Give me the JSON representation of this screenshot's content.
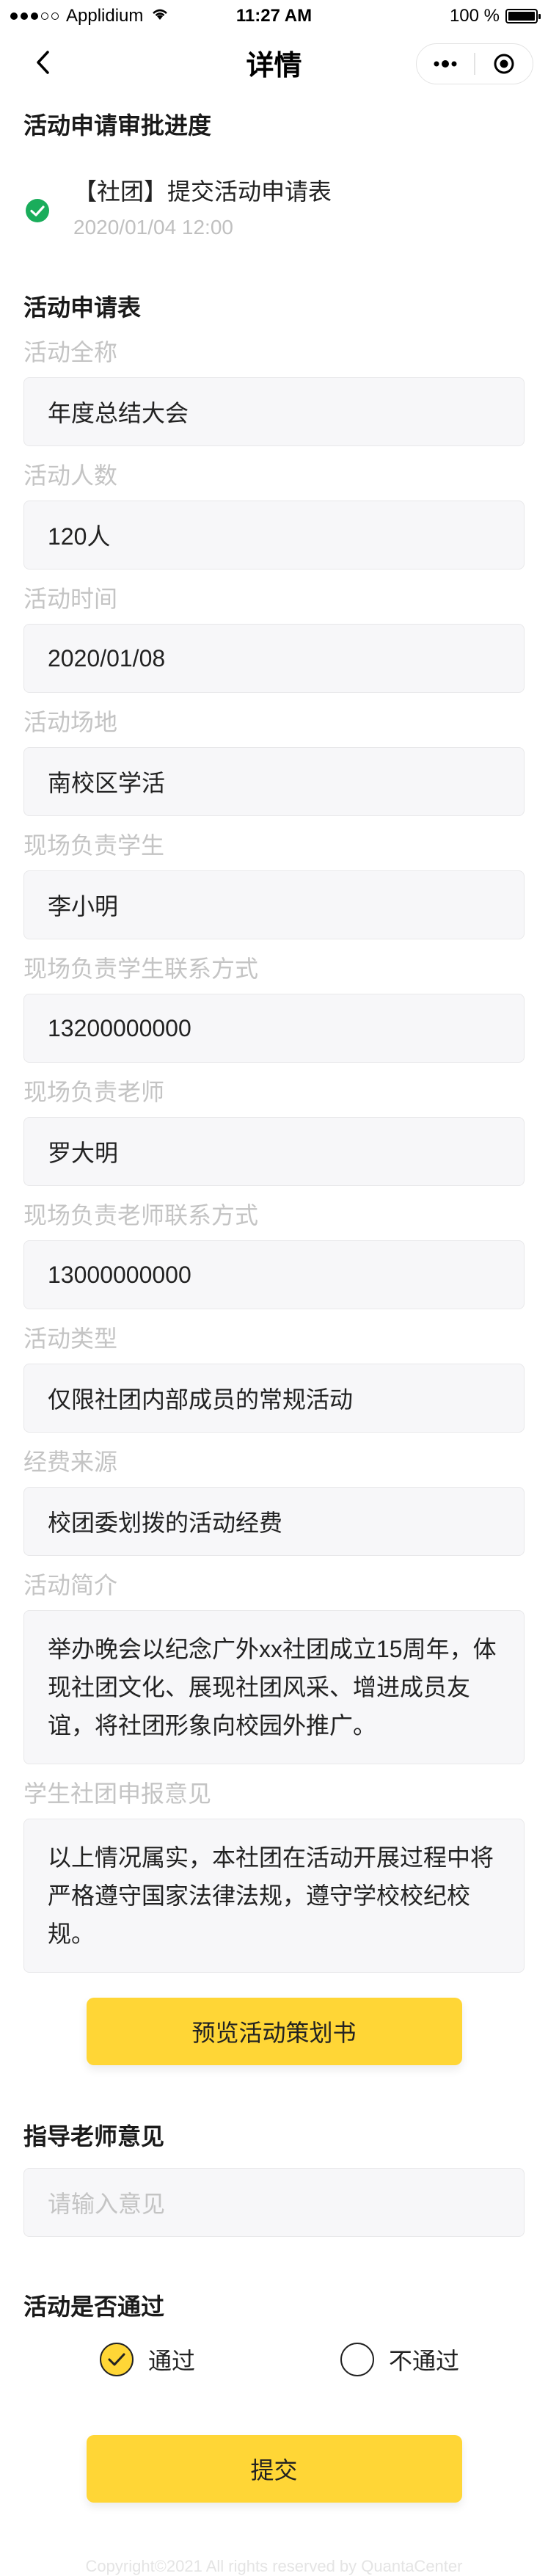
{
  "status_bar": {
    "carrier": "Applidium",
    "time": "11:27 AM",
    "battery": "100 %"
  },
  "nav": {
    "title": "详情",
    "back_icon": "chevron-left-icon",
    "more_icon": "more-dots-icon",
    "close_icon": "target-circle-icon"
  },
  "approval": {
    "section_title": "活动申请审批进度",
    "step_title": "【社团】提交活动申请表",
    "step_time": "2020/01/04 12:00",
    "status_icon": "check-circle-icon",
    "status_color": "#1aad5b"
  },
  "form": {
    "title": "活动申请表",
    "fields": [
      {
        "label": "活动全称",
        "value": "年度总结大会"
      },
      {
        "label": "活动人数",
        "value": "120人"
      },
      {
        "label": "活动时间",
        "value": "2020/01/08"
      },
      {
        "label": "活动场地",
        "value": "南校区学活"
      },
      {
        "label": "现场负责学生",
        "value": "李小明"
      },
      {
        "label": "现场负责学生联系方式",
        "value": "13200000000"
      },
      {
        "label": "现场负责老师",
        "value": "罗大明"
      },
      {
        "label": "现场负责老师联系方式",
        "value": "13000000000"
      },
      {
        "label": "活动类型",
        "value": "仅限社团内部成员的常规活动"
      },
      {
        "label": "经费来源",
        "value": "校团委划拨的活动经费"
      },
      {
        "label": "活动简介",
        "value": "举办晚会以纪念广外xx社团成立15周年，体现社团文化、展现社团风采、增进成员友谊，将社团形象向校园外推广。"
      },
      {
        "label": "学生社团申报意见",
        "value": "以上情况属实，本社团在活动开展过程中将严格遵守国家法律法规，遵守学校校纪校规。"
      }
    ],
    "preview_button": "预览活动策划书"
  },
  "teacher": {
    "title": "指导老师意见",
    "placeholder": "请输入意见"
  },
  "decision": {
    "title": "活动是否通过",
    "options": [
      {
        "label": "通过",
        "selected": true
      },
      {
        "label": "不通过",
        "selected": false
      }
    ],
    "submit_button": "提交"
  },
  "footer": {
    "copyright": "Copyright©2021 All rights reserved by QuantaCenter"
  },
  "colors": {
    "accent": "#ffd636",
    "field_bg": "#f7f7f9",
    "label": "#c4c4c4"
  }
}
